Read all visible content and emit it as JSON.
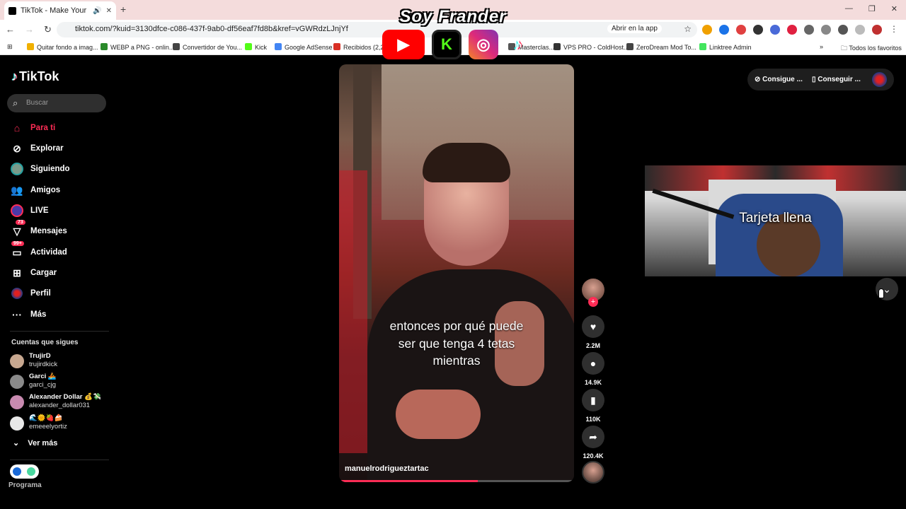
{
  "browser": {
    "tab_title": "TikTok - Make Your Day",
    "url": "tiktok.com/?kuid=3130dfce-c086-437f-9ab0-df56eaf7fd8b&kref=vGWRdzLJnjYf",
    "open_app": "Abrir en la app",
    "bookmarks": [
      {
        "label": "Quitar fondo a imag...",
        "color": "#f0b000"
      },
      {
        "label": "WEBP a PNG - onlin...",
        "color": "#2a8a2a"
      },
      {
        "label": "Convertidor de You...",
        "color": "#444444"
      },
      {
        "label": "Kick",
        "color": "#53fc18"
      },
      {
        "label": "Google AdSense",
        "color": "#4285f4"
      },
      {
        "label": "Recibidos (2,229)",
        "color": "#d93025"
      },
      {
        "label": "Masterclas...",
        "color": "#555555"
      },
      {
        "label": "VPS PRO - ColdHost...",
        "color": "#333333"
      },
      {
        "label": "ZeroDream Mod To...",
        "color": "#444444"
      },
      {
        "label": "Linktree Admin",
        "color": "#43e55e"
      }
    ],
    "all_favorites": "Todos los favoritos"
  },
  "overlay": {
    "title": "Soy Frander",
    "icons": [
      "youtube-icon",
      "kick-icon",
      "instagram-icon",
      "tiktok-icon"
    ]
  },
  "sidebar": {
    "logo": "TikTok",
    "search_placeholder": "Buscar",
    "items": [
      {
        "label": "Para ti",
        "icon": "home-icon",
        "active": true
      },
      {
        "label": "Explorar",
        "icon": "compass-icon"
      },
      {
        "label": "Siguiendo",
        "icon": "following-avatar-icon"
      },
      {
        "label": "Amigos",
        "icon": "friends-icon"
      },
      {
        "label": "LIVE",
        "icon": "live-icon"
      },
      {
        "label": "Mensajes",
        "icon": "messages-icon",
        "badge": "73"
      },
      {
        "label": "Actividad",
        "icon": "activity-icon",
        "badge": "99+"
      },
      {
        "label": "Cargar",
        "icon": "upload-icon"
      },
      {
        "label": "Perfil",
        "icon": "profile-avatar-icon"
      },
      {
        "label": "Más",
        "icon": "more-icon"
      }
    ],
    "following_label": "Cuentas que sigues",
    "accounts": [
      {
        "name": "TrujirD",
        "user": "trujirdkick"
      },
      {
        "name": "Garci 🚣",
        "user": "garci_cjg"
      },
      {
        "name": "Alexander Dollar 💰💸",
        "user": "alexander_dollar031"
      },
      {
        "name": "🌊🌞🍓🍰",
        "user": "emeeelyortiz"
      }
    ],
    "see_more": "Ver más",
    "program_label": "Programa"
  },
  "video": {
    "subtitle_lines": [
      "entonces por qué puede",
      "ser que tenga 4 tetas",
      "mientras"
    ],
    "username": "manuelrodrigueztartac",
    "progress": 0.59
  },
  "actions": {
    "likes": "2.2M",
    "comments": "14.9K",
    "saves": "110K",
    "shares": "120.4K"
  },
  "topright": {
    "btn_a": "Consigue ...",
    "btn_b": "Conseguir ..."
  },
  "webcam": {
    "caption": "Tarjeta llena"
  }
}
